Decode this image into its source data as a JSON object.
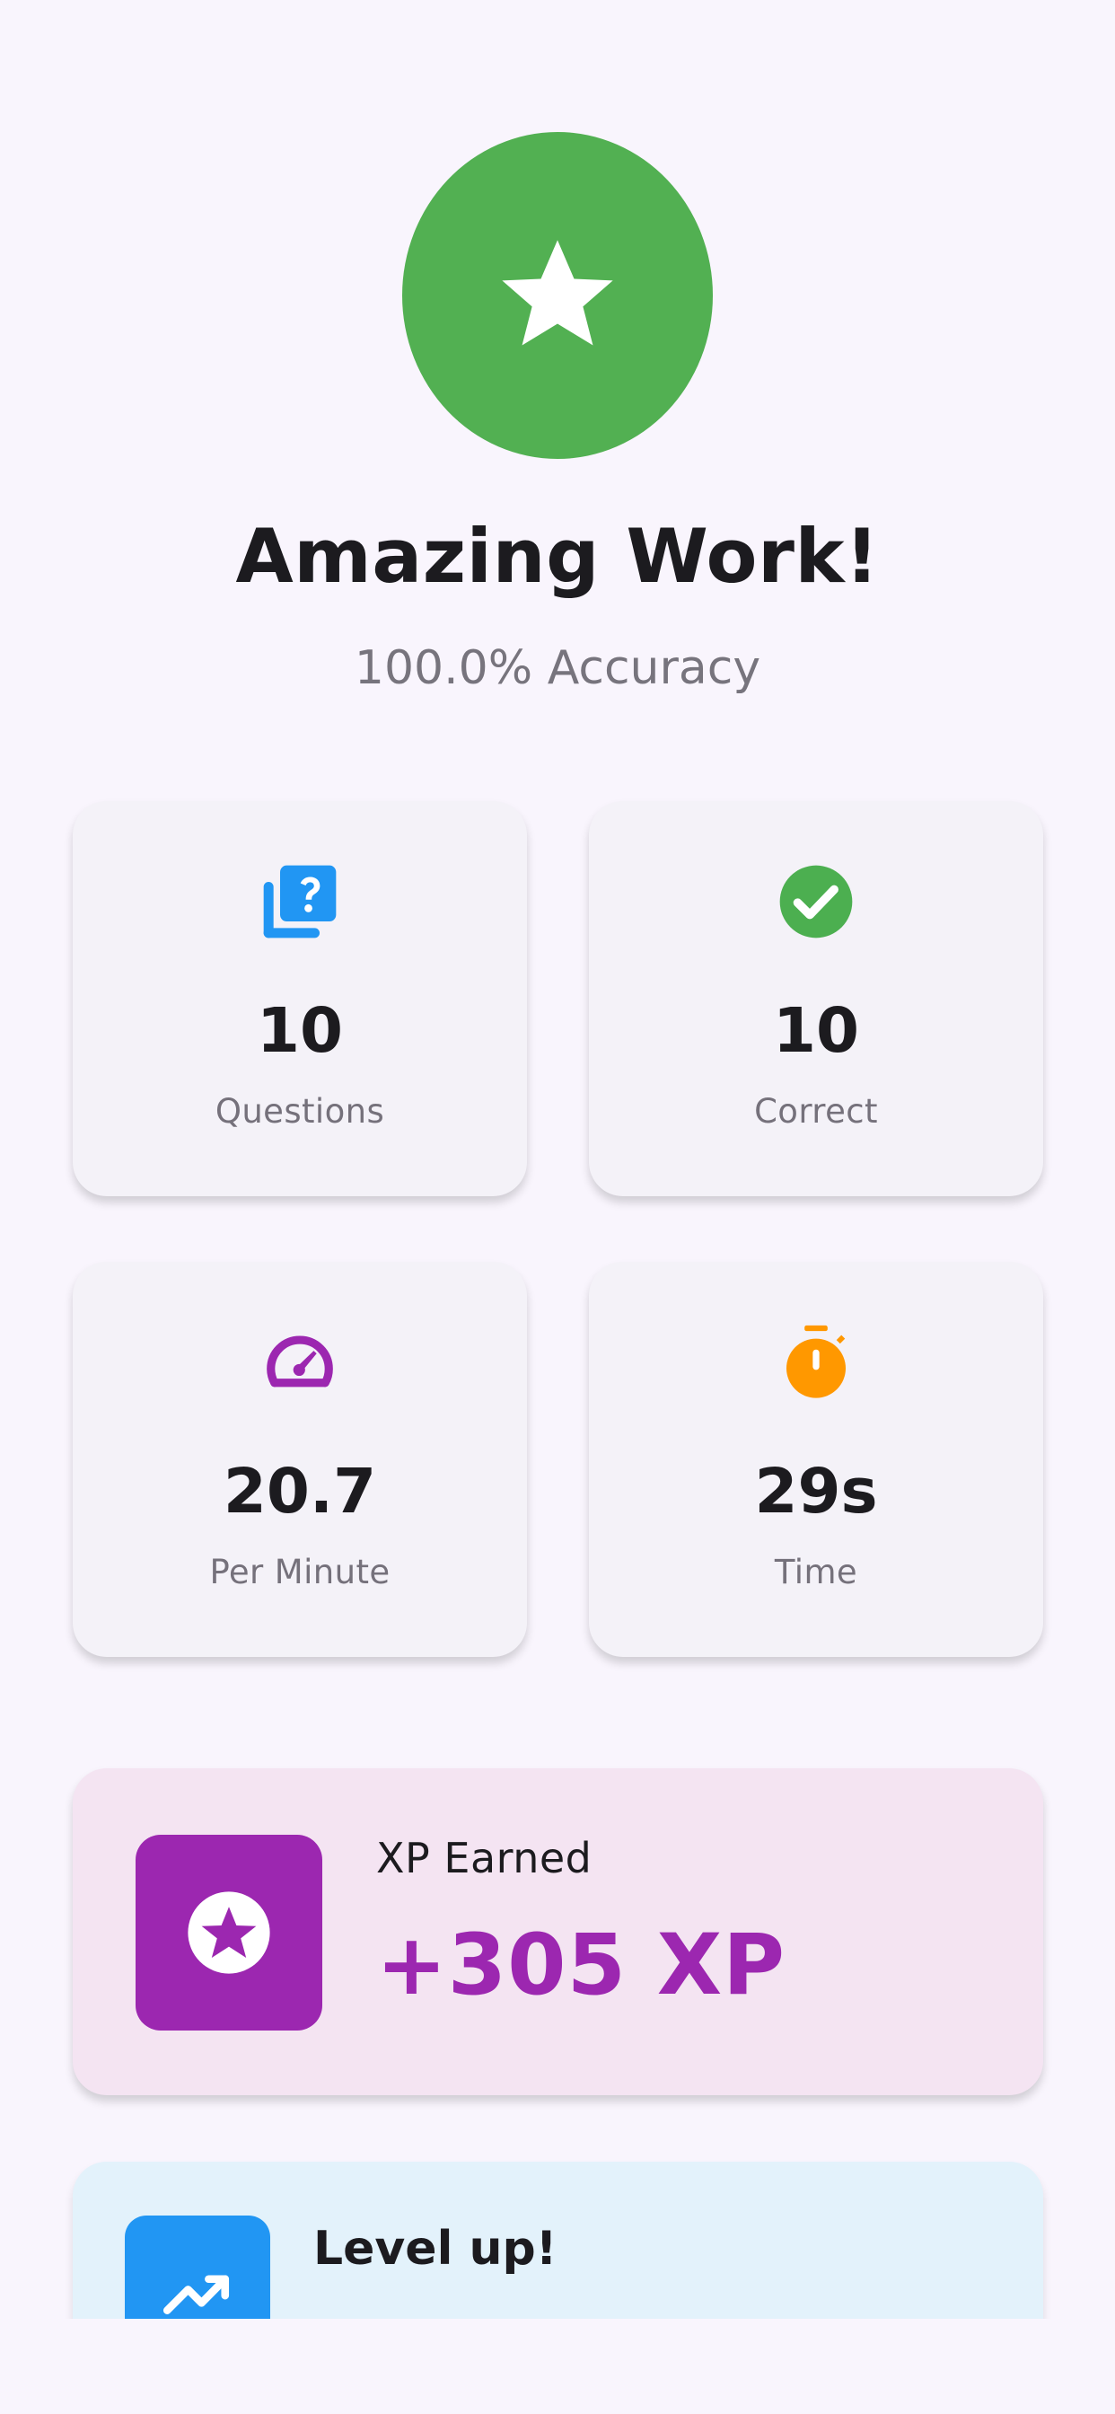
{
  "result": {
    "badge_icon": "star-icon",
    "title": "Amazing Work!",
    "accuracy": "100.0% Accuracy"
  },
  "stats": [
    {
      "icon": "quiz-icon",
      "value": "10",
      "label": "Questions",
      "color": "#2196f3"
    },
    {
      "icon": "check-circle-icon",
      "value": "10",
      "label": "Correct",
      "color": "#4caf50"
    },
    {
      "icon": "speed-icon",
      "value": "20.7",
      "label": "Per Minute",
      "color": "#9c27b0"
    },
    {
      "icon": "timer-icon",
      "value": "29s",
      "label": "Time",
      "color": "#ff9800"
    }
  ],
  "xp": {
    "icon": "stars-icon",
    "title": "XP Earned",
    "value": "+305 XP",
    "color": "#9c27b0",
    "background": "#f4e4f2"
  },
  "level_up": {
    "icon": "trending-up-icon",
    "title": "Level up!",
    "color": "#2196f3",
    "background": "#e3f2fb"
  },
  "colors": {
    "background": "#f9f5fd",
    "success": "#52b052",
    "card": "#f4f2f8",
    "text": "#1c1b1f",
    "muted_text": "#77747d"
  }
}
